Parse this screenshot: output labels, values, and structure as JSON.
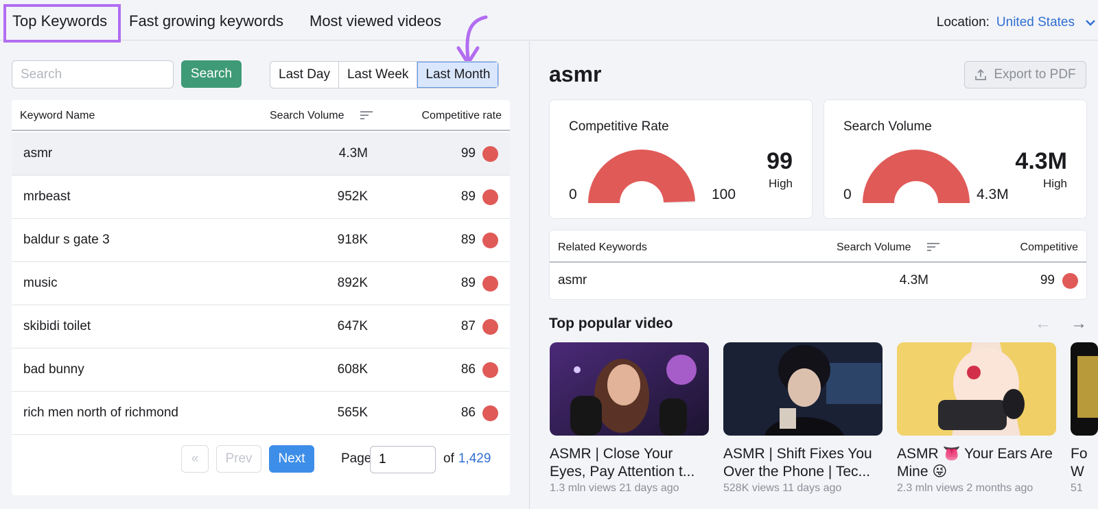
{
  "tabs": [
    {
      "label": "Top Keywords",
      "active": true
    },
    {
      "label": "Fast growing keywords",
      "active": false
    },
    {
      "label": "Most viewed videos",
      "active": false
    }
  ],
  "location": {
    "label": "Location:",
    "value": "United States"
  },
  "search": {
    "placeholder": "Search",
    "button": "Search"
  },
  "periods": [
    "Last Day",
    "Last Week",
    "Last Month"
  ],
  "active_period": "Last Month",
  "table": {
    "headers": {
      "name": "Keyword Name",
      "volume": "Search Volume",
      "rate": "Competitive rate"
    },
    "rows": [
      {
        "name": "asmr",
        "volume": "4.3M",
        "rate": "99"
      },
      {
        "name": "mrbeast",
        "volume": "952K",
        "rate": "89"
      },
      {
        "name": "baldur s gate 3",
        "volume": "918K",
        "rate": "89"
      },
      {
        "name": "music",
        "volume": "892K",
        "rate": "89"
      },
      {
        "name": "skibidi toilet",
        "volume": "647K",
        "rate": "87"
      },
      {
        "name": "bad bunny",
        "volume": "608K",
        "rate": "86"
      },
      {
        "name": "rich men north of richmond",
        "volume": "565K",
        "rate": "86"
      }
    ]
  },
  "pager": {
    "first": "«",
    "prev": "Prev",
    "next": "Next",
    "page_label": "Page:",
    "page_value": "1",
    "of_label": "of",
    "total": "1,429"
  },
  "detail": {
    "keyword": "asmr",
    "export": "Export to PDF",
    "competitive": {
      "title": "Competitive Rate",
      "min": "0",
      "max": "100",
      "value": "99",
      "level": "High",
      "fill": 0.99
    },
    "volume": {
      "title": "Search Volume",
      "min": "0",
      "max": "4.3M",
      "value": "4.3M",
      "level": "High",
      "fill": 1.0
    }
  },
  "related": {
    "headers": {
      "name": "Related Keywords",
      "volume": "Search Volume",
      "rate": "Competitive"
    },
    "rows": [
      {
        "name": "asmr",
        "volume": "4.3M",
        "rate": "99"
      }
    ]
  },
  "popular": {
    "title": "Top popular video",
    "prev_arrow": "←",
    "next_arrow": "→",
    "videos": [
      {
        "title": "ASMR | Close Your Eyes, Pay Attention t...",
        "meta": "1.3 mln views 21 days ago"
      },
      {
        "title": "ASMR | Shift Fixes You Over the Phone | Tec...",
        "meta": "528K views 11 days ago"
      },
      {
        "title": "ASMR 👅 Your Ears Are Mine 😜",
        "meta": "2.3 mln views 2 months ago"
      },
      {
        "title": "Fo W",
        "meta": "51"
      }
    ]
  },
  "colors": {
    "accent": "#3d8ee8",
    "search_green": "#3f9a78",
    "gauge_red": "#e05a57",
    "highlight": "#b26df1",
    "link": "#2f6fd1"
  }
}
